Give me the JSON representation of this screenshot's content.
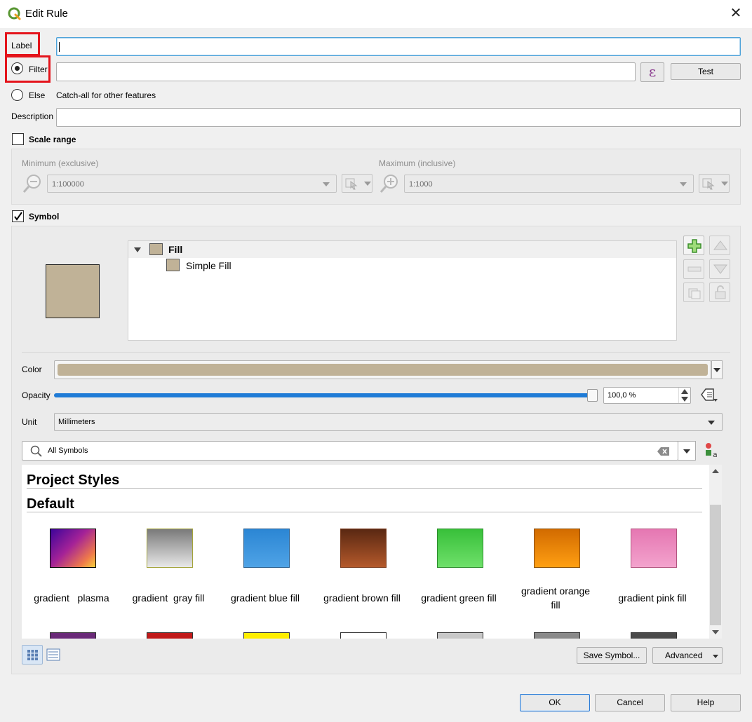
{
  "window": {
    "title": "Edit Rule"
  },
  "form": {
    "label_text": "Label",
    "label_value": "",
    "filter_text": "Filter",
    "filter_value": "",
    "epsilon_symbol": "ε",
    "test_button": "Test",
    "else_text": "Else",
    "else_hint": "Catch-all for other features",
    "description_text": "Description",
    "description_value": ""
  },
  "scale_range": {
    "title": "Scale range",
    "minimum_label": "Minimum (exclusive)",
    "minimum_value": "1:100000",
    "maximum_label": "Maximum (inclusive)",
    "maximum_value": "1:1000"
  },
  "symbol": {
    "title": "Symbol",
    "checked": true,
    "fill_color": "#c0b297",
    "tree": {
      "fill_label": "Fill",
      "simple_fill_label": "Simple Fill"
    },
    "color_label": "Color",
    "opacity_label": "Opacity",
    "opacity_value": "100,0 %",
    "opacity_fraction": 1.0,
    "unit_label": "Unit",
    "unit_value": "Millimeters",
    "search_value": "All Symbols",
    "sections": {
      "project_styles": "Project Styles",
      "default": "Default"
    },
    "gallery": [
      {
        "name": "gradient   plasma",
        "style": "linear-gradient(135deg, #3d049b 0%, #a42297 45%, #ef7a4a 80%, #f7d13d 100%)",
        "border": "#000000"
      },
      {
        "name": "gradient  gray fill",
        "style": "linear-gradient(180deg, #7a7a7a 0%, #e8e8e8 100%)",
        "border": "#a3a33a"
      },
      {
        "name": "gradient blue fill",
        "style": "linear-gradient(180deg, #2b86d4 0%, #4fa3e6 100%)",
        "border": "#2a5f8f"
      },
      {
        "name": "gradient brown fill",
        "style": "linear-gradient(180deg, #5a2812 0%, #b4592b 100%)",
        "border": "#7a3b1d"
      },
      {
        "name": "gradient green fill",
        "style": "linear-gradient(180deg, #38c03a 0%, #6ee06a 100%)",
        "border": "#2c8d2c"
      },
      {
        "name": "gradient orange fill",
        "style": "linear-gradient(180deg, #d26b00 0%, #ff9f12 100%)",
        "border": "#8a4d00"
      },
      {
        "name": "gradient pink fill",
        "style": "linear-gradient(180deg, #e577b2 0%, #f3a3cd 100%)",
        "border": "#b2547f"
      }
    ],
    "gallery_row2_colors": [
      "#6a2a78",
      "#c01a1a",
      "#ffee00",
      "#ffffff",
      "#c8c8c8",
      "#8a8a8a",
      "#4a4a4a"
    ],
    "save_symbol_button": "Save Symbol...",
    "advanced_button": "Advanced"
  },
  "footer": {
    "ok_button": "OK",
    "cancel_button": "Cancel",
    "help_button": "Help"
  }
}
